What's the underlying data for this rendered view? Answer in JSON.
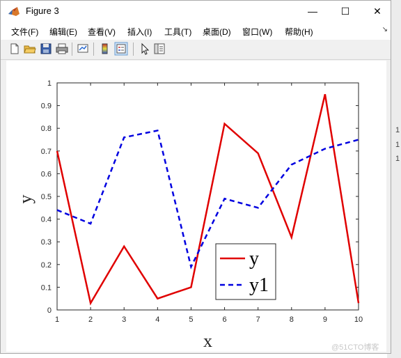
{
  "window": {
    "title": "Figure 3",
    "minimize": "—",
    "maximize": "☐",
    "close": "✕"
  },
  "menu": [
    "文件(F)",
    "编辑(E)",
    "查看(V)",
    "插入(I)",
    "工具(T)",
    "桌面(D)",
    "窗口(W)",
    "帮助(H)"
  ],
  "toolbar": [
    "new-figure-icon",
    "open-file-icon",
    "save-icon",
    "print-icon",
    "link-plot-icon",
    "colorbar-icon",
    "legend-icon",
    "pointer-icon",
    "plot-tools-icon"
  ],
  "watermark": "@51CTO博客",
  "side_marks": [
    "1",
    "1",
    "1"
  ],
  "chart_data": {
    "type": "line",
    "x": [
      1,
      2,
      3,
      4,
      5,
      6,
      7,
      8,
      9,
      10
    ],
    "series": [
      {
        "name": "y",
        "color": "#e00000",
        "style": "solid",
        "values": [
          0.7,
          0.03,
          0.28,
          0.05,
          0.1,
          0.82,
          0.69,
          0.32,
          0.95,
          0.03
        ]
      },
      {
        "name": "y1",
        "color": "#0000e0",
        "style": "dashed",
        "values": [
          0.44,
          0.38,
          0.76,
          0.79,
          0.19,
          0.49,
          0.45,
          0.64,
          0.71,
          0.75
        ]
      }
    ],
    "xlabel": "x",
    "ylabel": "y",
    "xlim": [
      1,
      10
    ],
    "ylim": [
      0,
      1
    ],
    "xticks": [
      "1",
      "2",
      "3",
      "4",
      "5",
      "6",
      "7",
      "8",
      "9",
      "10"
    ],
    "yticks": [
      "0",
      "0.1",
      "0.2",
      "0.3",
      "0.4",
      "0.5",
      "0.6",
      "0.7",
      "0.8",
      "0.9",
      "1"
    ],
    "legend": {
      "position": "bottom-center",
      "labels": [
        "y",
        "y1"
      ]
    },
    "grid": false
  }
}
